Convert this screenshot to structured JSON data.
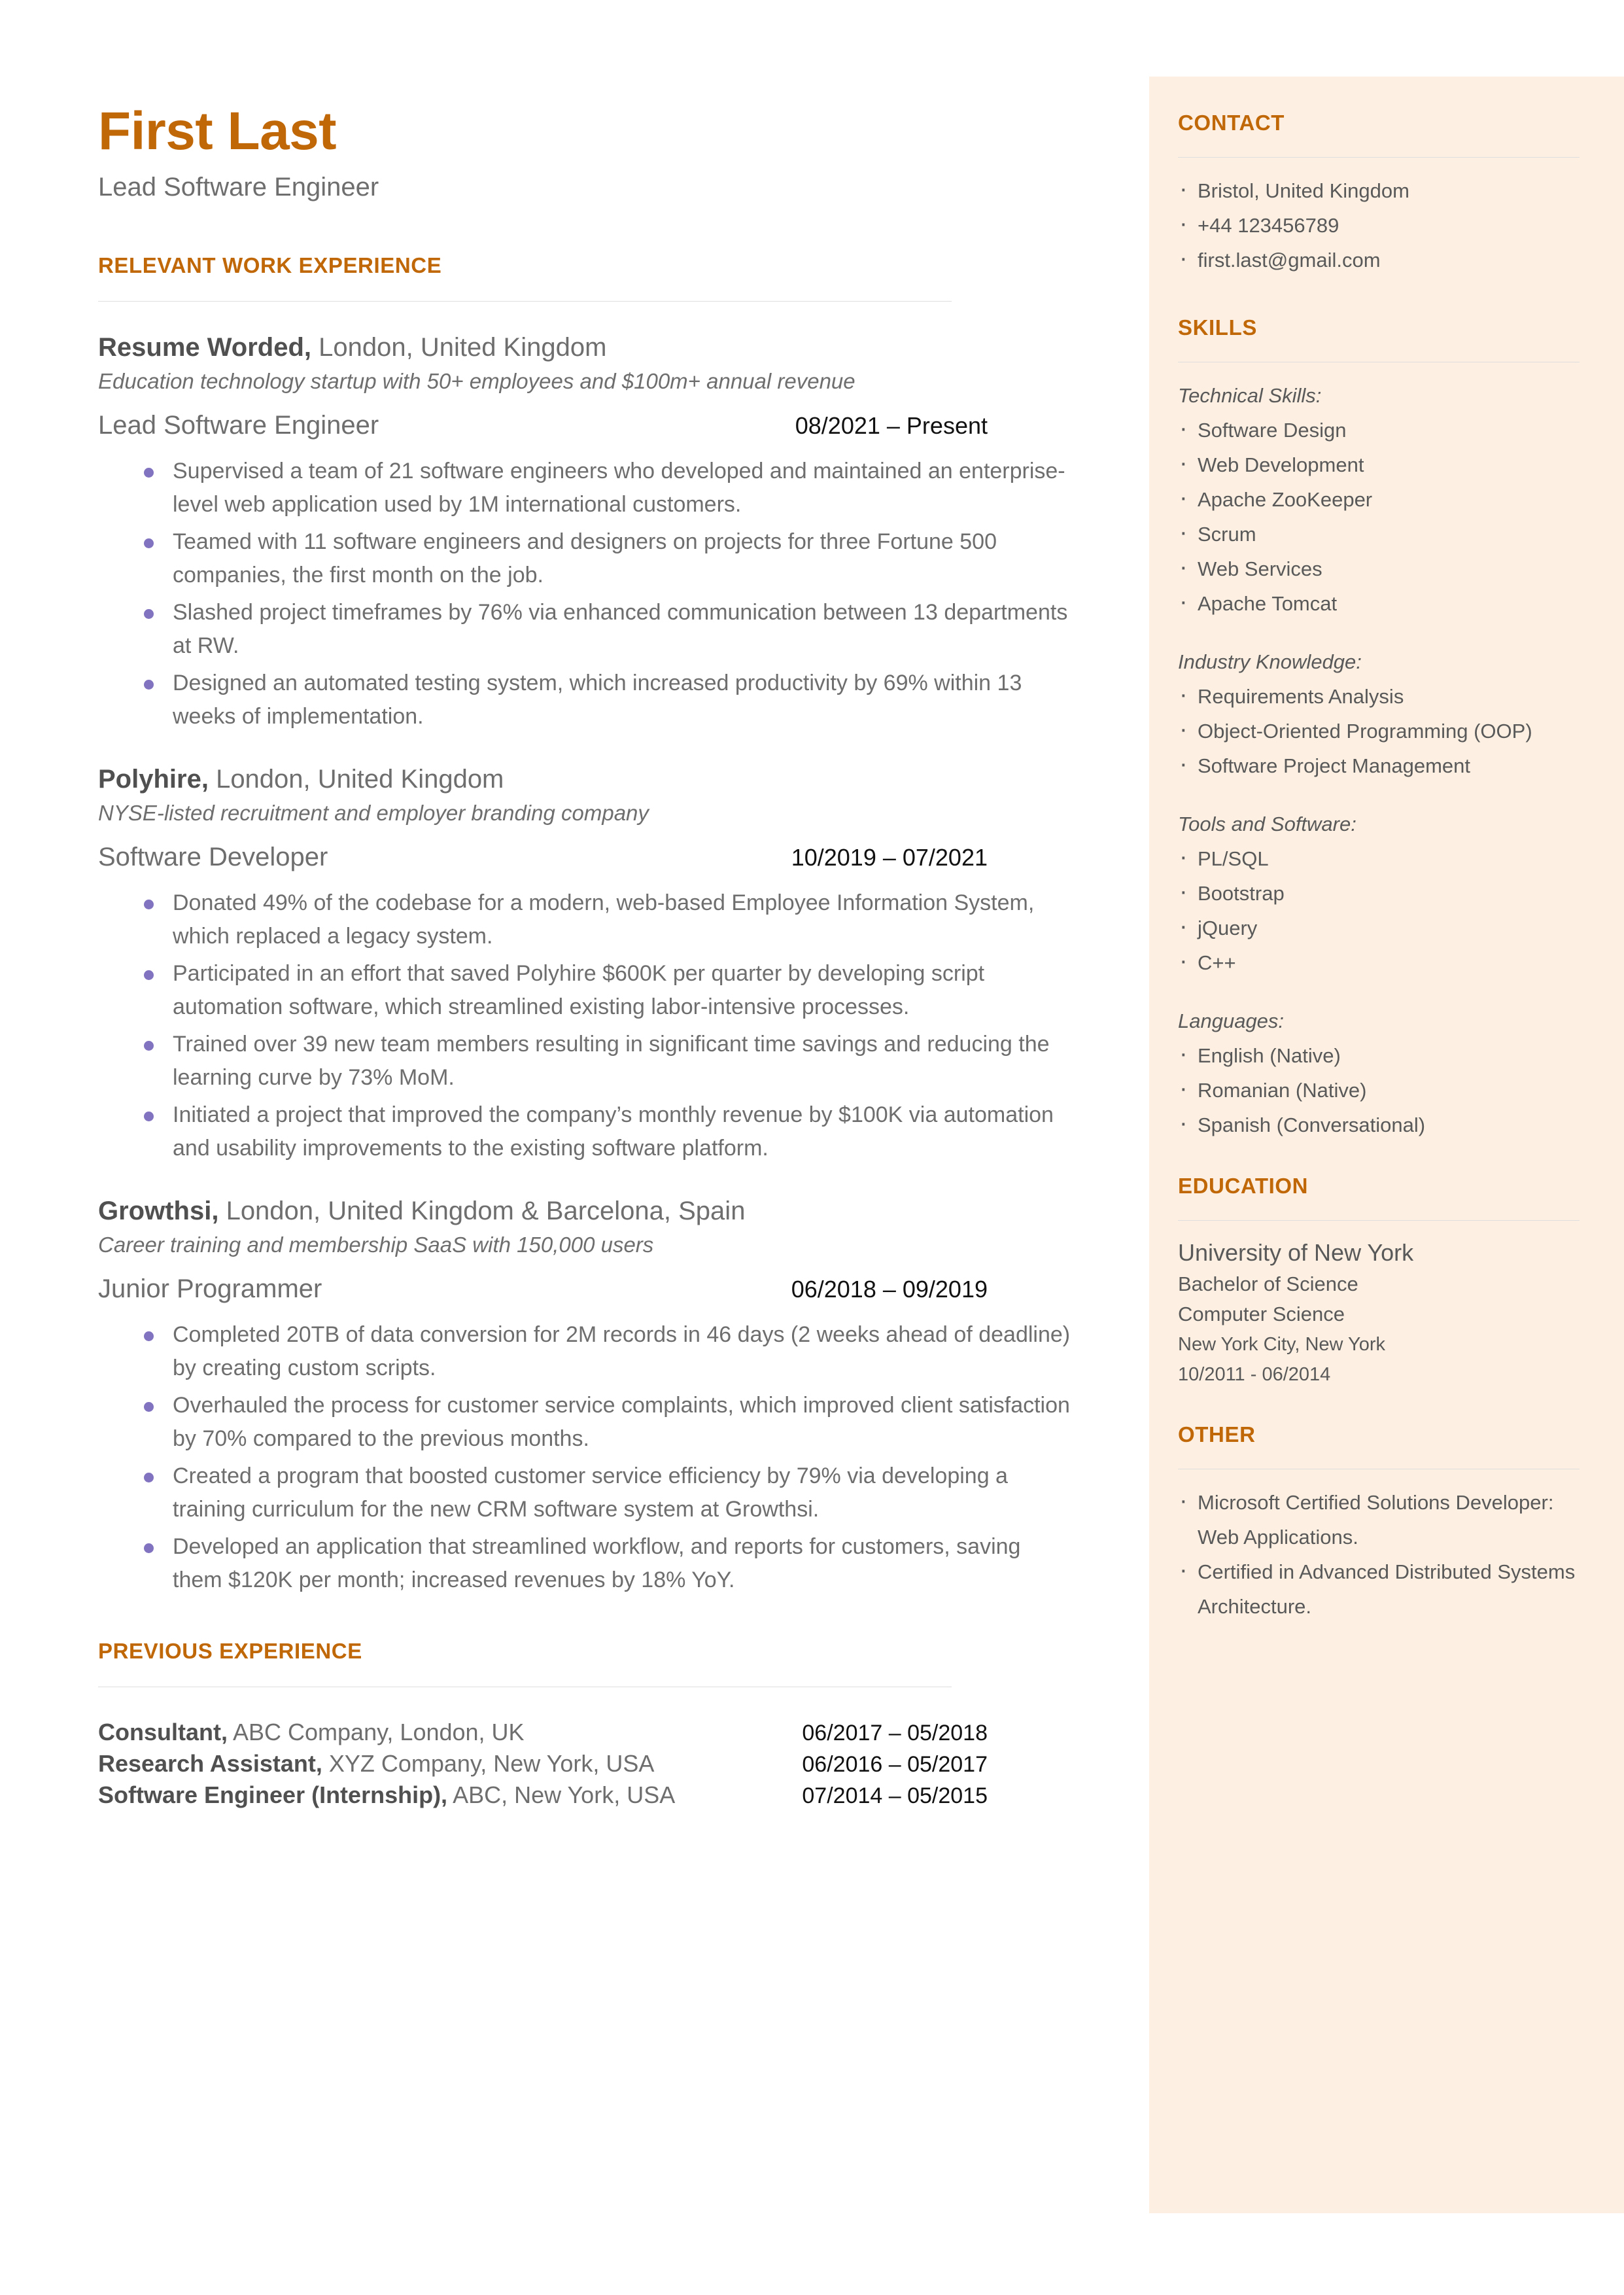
{
  "header": {
    "name": "First Last",
    "title": "Lead Software Engineer"
  },
  "sections": {
    "work_heading": "RELEVANT WORK EXPERIENCE",
    "previous_heading": "PREVIOUS EXPERIENCE"
  },
  "jobs": [
    {
      "company": "Resume Worded,",
      "location": " London, United Kingdom",
      "tagline": "Education technology startup with 50+ employees and $100m+ annual revenue",
      "role": "Lead Software Engineer",
      "dates": "08/2021 – Present",
      "bullets": [
        "Supervised a team of 21 software engineers who developed and maintained an enterprise-level web application used by 1M international customers.",
        "Teamed with 11 software engineers and designers on projects for three Fortune 500 companies, the first month on the job.",
        "Slashed project timeframes by 76% via enhanced communication between 13 departments at RW.",
        "Designed an automated testing system, which increased productivity by 69% within 13 weeks of implementation."
      ]
    },
    {
      "company": "Polyhire,",
      "location": " London, United Kingdom",
      "tagline": "NYSE-listed recruitment and employer branding company",
      "role": "Software Developer",
      "dates": "10/2019 – 07/2021",
      "bullets": [
        "Donated 49% of the codebase for a modern, web-based Employee Information System, which replaced a legacy system.",
        "Participated in an effort that saved Polyhire $600K per quarter by developing script automation software, which streamlined existing labor-intensive processes.",
        "Trained over 39 new team members resulting in significant time savings and reducing the learning curve by 73% MoM.",
        "Initiated a project that improved the company’s monthly revenue by $100K via automation and usability improvements to the existing software platform."
      ]
    },
    {
      "company": "Growthsi,",
      "location": " London, United Kingdom & Barcelona, Spain",
      "tagline": "Career training and membership SaaS with 150,000 users",
      "role": "Junior Programmer",
      "dates": "06/2018 – 09/2019",
      "bullets": [
        "Completed 20TB of data conversion for 2M records in 46 days (2 weeks ahead of deadline) by creating custom scripts.",
        "Overhauled the process for customer service complaints, which improved client satisfaction by 70% compared to the previous months.",
        "Created a program that boosted customer service efficiency by 79% via developing a training curriculum for the new CRM software system at Growthsi.",
        "Developed an application that streamlined workflow, and reports for customers, saving them $120K per month; increased revenues by 18% YoY."
      ]
    }
  ],
  "previous_experience": [
    {
      "role": "Consultant,",
      "detail": " ABC Company, London, UK",
      "dates": "06/2017 – 05/2018"
    },
    {
      "role": "Research Assistant,",
      "detail": " XYZ Company, New York, USA",
      "dates": "06/2016 – 05/2017"
    },
    {
      "role": "Software Engineer (Internship),",
      "detail": " ABC, New York, USA",
      "dates": "07/2014 – 05/2015"
    }
  ],
  "sidebar": {
    "contact": {
      "heading": "CONTACT",
      "items": [
        "Bristol, United Kingdom",
        "+44 123456789",
        "first.last@gmail.com"
      ]
    },
    "skills": {
      "heading": "SKILLS",
      "groups": [
        {
          "label": "Technical Skills:",
          "items": [
            "Software Design",
            "Web Development",
            "Apache ZooKeeper",
            "Scrum",
            "Web Services",
            "Apache Tomcat"
          ]
        },
        {
          "label": "Industry Knowledge:",
          "items": [
            "Requirements Analysis",
            "Object-Oriented Programming (OOP)",
            "Software Project Management"
          ]
        },
        {
          "label": "Tools and Software:",
          "items": [
            "PL/SQL",
            "Bootstrap",
            "jQuery",
            "C++"
          ]
        },
        {
          "label": "Languages:",
          "items": [
            "English (Native)",
            "Romanian (Native)",
            "Spanish (Conversational)"
          ]
        }
      ]
    },
    "education": {
      "heading": "EDUCATION",
      "school": "University of New York",
      "degree": "Bachelor of Science",
      "field": "Computer Science",
      "location": "New York City, New York",
      "dates": "10/2011 - 06/2014"
    },
    "other": {
      "heading": "OTHER",
      "items": [
        "Microsoft Certified Solutions Developer: Web Applications.",
        "Certified in Advanced Distributed Systems Architecture."
      ]
    }
  },
  "colors": {
    "accent": "#c06708",
    "sidebar_bg": "#fdf0e2",
    "body_text": "#6e6e6e",
    "bullet_dot": "#8273c0",
    "date_text": "#111111",
    "rule": "#dedede"
  }
}
